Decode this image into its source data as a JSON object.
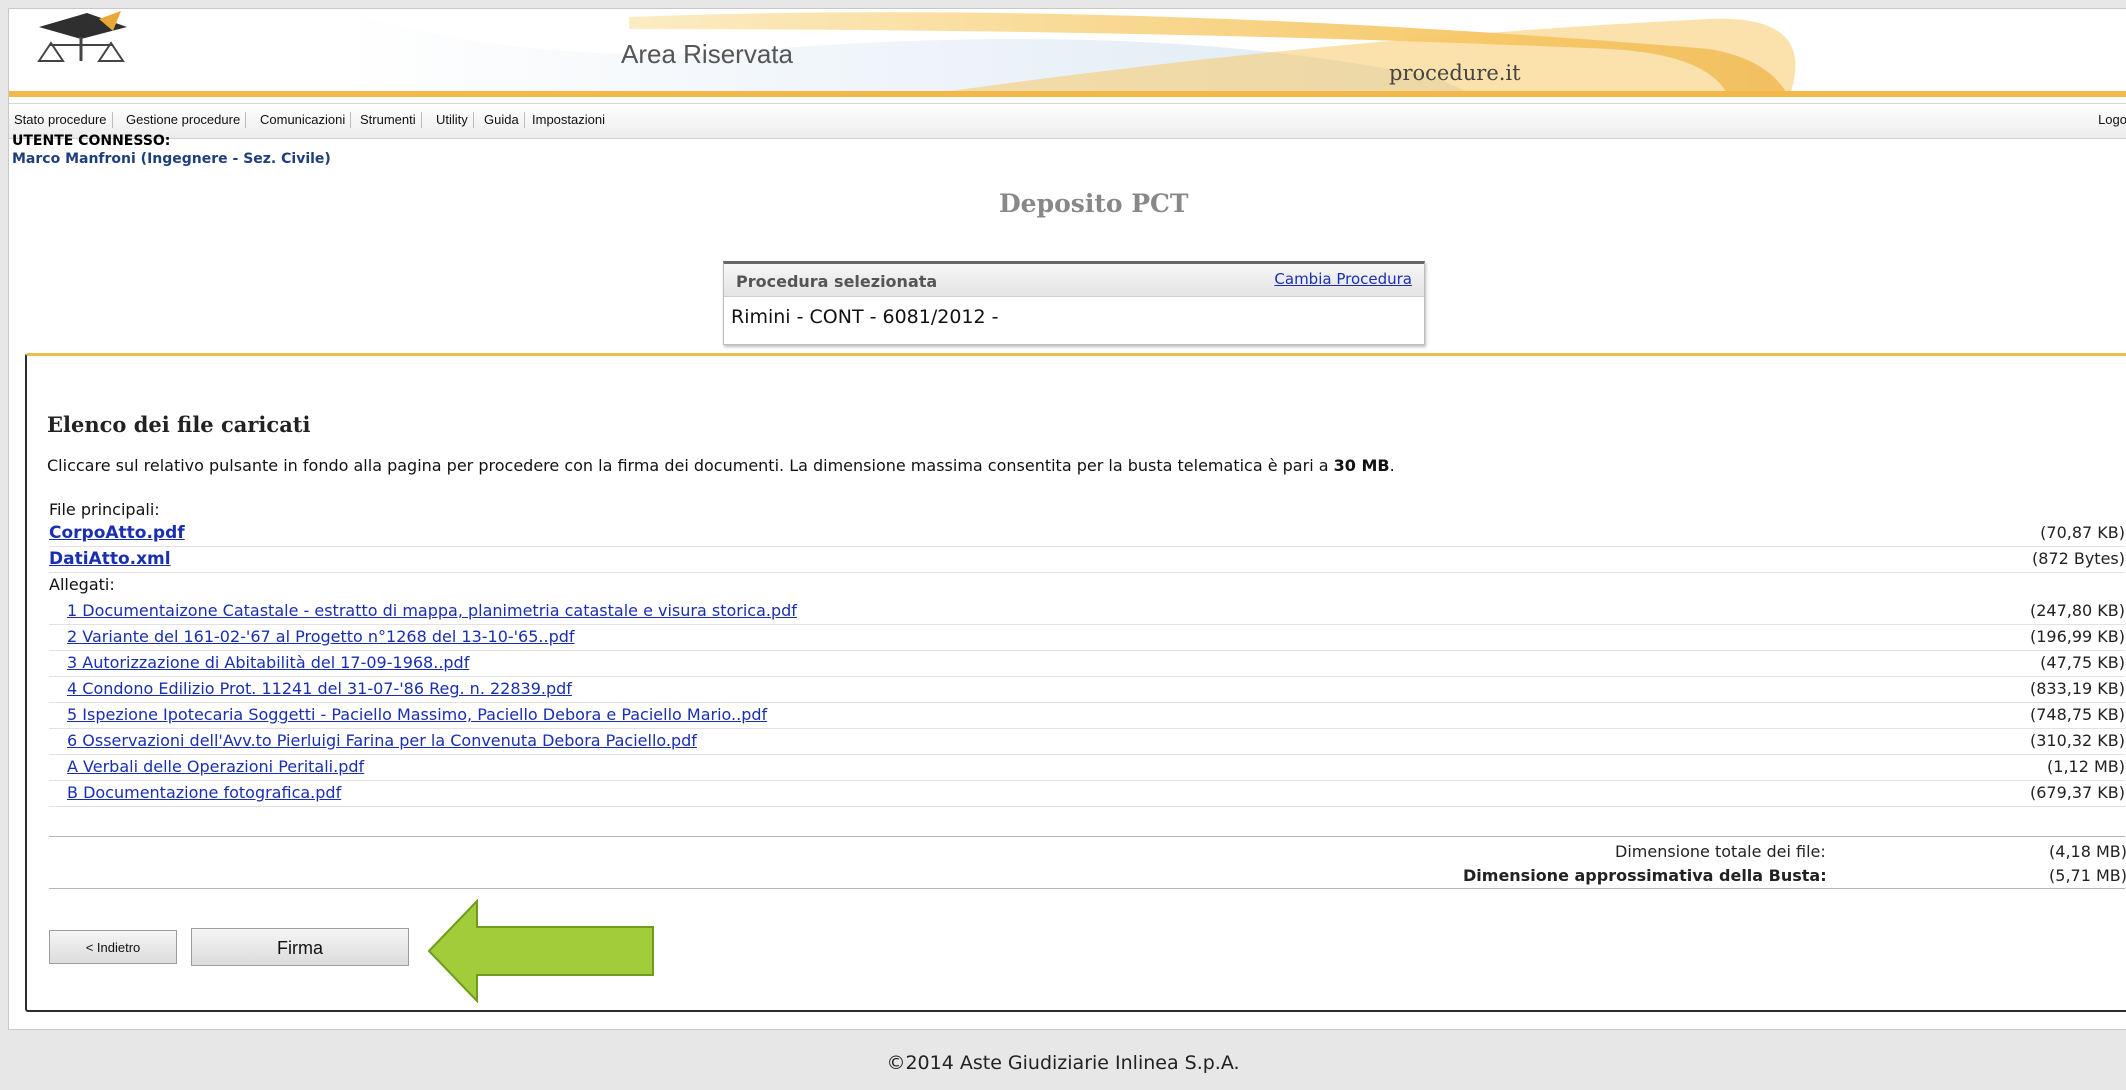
{
  "header": {
    "area_title": "Area Riservata",
    "logo_text": "procedure.it"
  },
  "menu": {
    "items": [
      "Stato procedure",
      "Gestione procedure",
      "Comunicazioni",
      "Strumenti",
      "Utility",
      "Guida",
      "Impostazioni"
    ],
    "logout": "Logo"
  },
  "user": {
    "label": "UTENTE CONNESSO:",
    "name": "Marco Manfroni (Ingegnere - Sez. Civile)"
  },
  "page": {
    "title": "Deposito PCT"
  },
  "procedure": {
    "label": "Procedura selezionata",
    "change_link": "Cambia Procedura",
    "value": "Rimini - CONT - 6081/2012 -"
  },
  "files": {
    "title": "Elenco dei file caricati",
    "instruction_prefix": "Cliccare sul relativo pulsante in fondo alla pagina per procedere con la firma dei documenti. La dimensione massima consentita per la busta telematica è pari a ",
    "instruction_max": "30 MB",
    "instruction_suffix": ".",
    "main_label": "File principali:",
    "main_files": [
      {
        "name": "CorpoAtto.pdf",
        "size": "(70,87 KB)"
      },
      {
        "name": "DatiAtto.xml",
        "size": "(872 Bytes)"
      }
    ],
    "attachments_label": "Allegati:",
    "attachments": [
      {
        "name": "1 Documentaizone Catastale - estratto di mappa, planimetria catastale e visura storica.pdf",
        "size": "(247,80 KB)"
      },
      {
        "name": "2 Variante del 161-02-'67 al Progetto n°1268 del 13-10-'65..pdf",
        "size": "(196,99 KB)"
      },
      {
        "name": "3 Autorizzazione di Abitabilità del 17-09-1968..pdf",
        "size": "(47,75 KB)"
      },
      {
        "name": "4 Condono Edilizio Prot. 11241 del 31-07-'86 Reg. n. 22839.pdf",
        "size": "(833,19 KB)"
      },
      {
        "name": "5 Ispezione Ipotecaria Soggetti - Paciello Massimo, Paciello Debora e Paciello Mario..pdf",
        "size": "(748,75 KB)"
      },
      {
        "name": "6 Osservazioni dell'Avv.to Pierluigi Farina per la Convenuta Debora Paciello.pdf",
        "size": "(310,32 KB)"
      },
      {
        "name": "A Verbali delle Operazioni Peritali.pdf",
        "size": "(1,12 MB)"
      },
      {
        "name": "B Documentazione fotografica.pdf",
        "size": "(679,37 KB)"
      }
    ],
    "total_label": "Dimensione totale dei file:",
    "total_value": "(4,18 MB)",
    "envelope_label": "Dimensione approssimativa della Busta:",
    "envelope_value": "(5,71 MB)"
  },
  "buttons": {
    "back": "< Indietro",
    "sign": "Firma"
  },
  "footer": {
    "copyright": "©2014 Aste Giudiziarie Inlinea S.p.A."
  },
  "colors": {
    "accent": "#e3c14a",
    "link": "#1a2fb0",
    "arrow": "#a3cc3a"
  }
}
